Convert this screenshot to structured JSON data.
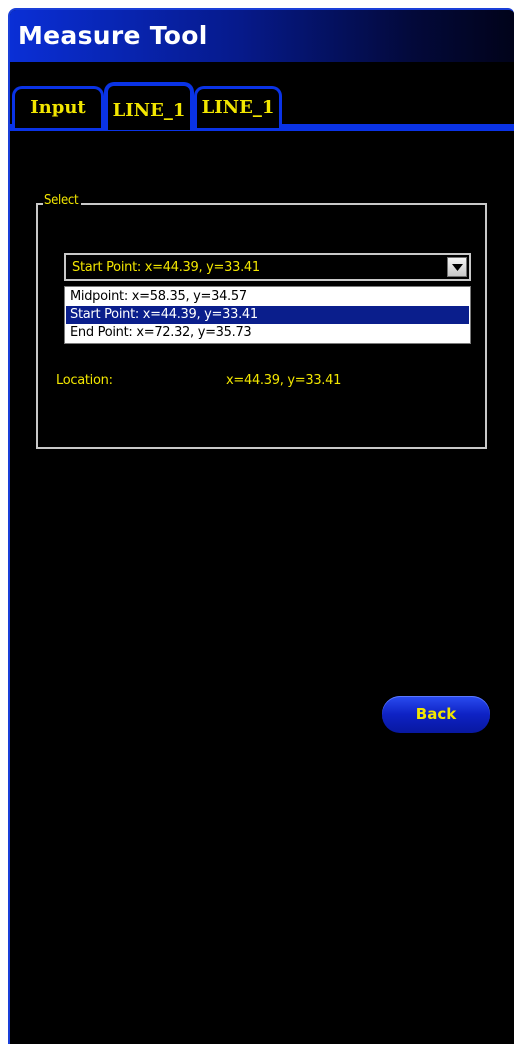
{
  "window": {
    "title": "Measure Tool"
  },
  "tabs": [
    {
      "label": "Input",
      "selected": false
    },
    {
      "label": "LINE_1",
      "selected": true
    },
    {
      "label": "LINE_1",
      "selected": false
    }
  ],
  "select_group": {
    "legend": "Select",
    "combo": {
      "value": "Start Point: x=44.39, y=33.41"
    },
    "options": [
      {
        "label": "Midpoint: x=58.35, y=34.57",
        "selected": false
      },
      {
        "label": "Start Point: x=44.39, y=33.41",
        "selected": true
      },
      {
        "label": "End Point: x=72.32, y=35.73",
        "selected": false
      }
    ],
    "location": {
      "label": "Location:",
      "value": "x=44.39, y=33.41"
    }
  },
  "back_button": {
    "label": "Back"
  },
  "colors": {
    "background": "#000000",
    "accent_blue": "#0a33e6",
    "text_yellow": "#f2e600",
    "selection": "#0a1e8c"
  },
  "icons": {
    "combo_arrow": "chevron-down-icon"
  }
}
